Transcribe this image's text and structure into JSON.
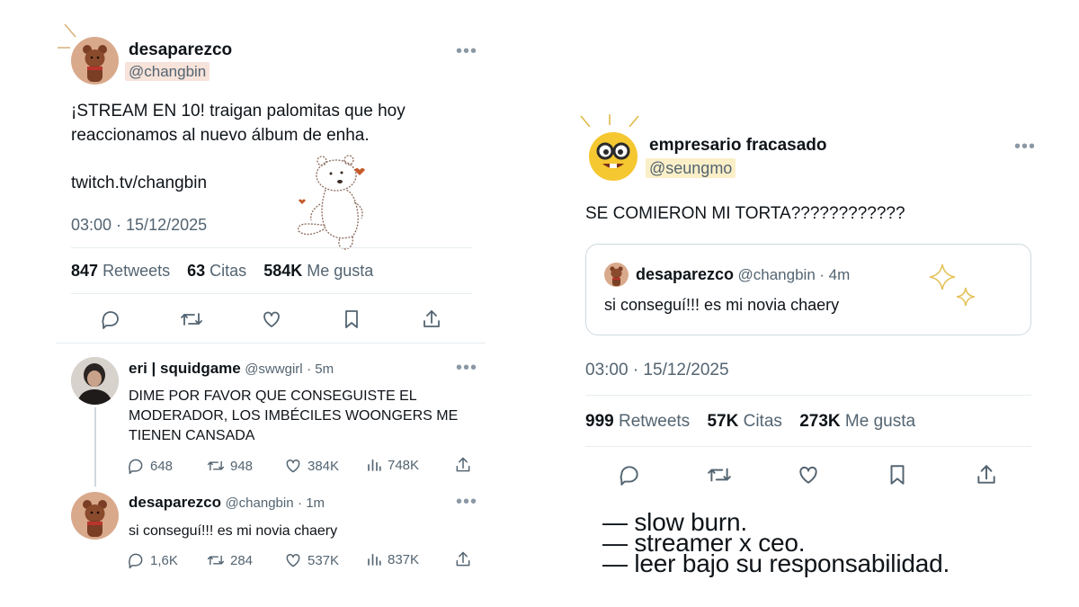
{
  "left_tweet": {
    "display_name": "desaparezco",
    "handle": "@changbin",
    "text_line1": "¡STREAM EN 10! traigan palomitas que hoy",
    "text_line2": "reaccionamos al nuevo álbum de enha.",
    "link": "twitch.tv/changbin",
    "timestamp": "03:00 · 15/12/2025",
    "retweets_count": "847",
    "retweets_label": "Retweets",
    "quotes_count": "63",
    "quotes_label": "Citas",
    "likes_count": "584K",
    "likes_label": "Me gusta"
  },
  "replies": [
    {
      "display_name": "eri | squidgame",
      "handle": "@swwgirl",
      "time": "· 5m",
      "text_line1": "DIME POR FAVOR QUE CONSEGUISTE EL",
      "text_line2": "MODERADOR, LOS IMBÉCILES WOONGERS ME",
      "text_line3": "TIENEN CANSADA",
      "replies": "648",
      "retweets": "948",
      "likes": "384K",
      "views": "748K"
    },
    {
      "display_name": "desaparezco",
      "handle": "@changbin",
      "time": "· 1m",
      "text_line1": "si conseguí!!! es mi novia chaery",
      "replies": "1,6K",
      "retweets": "284",
      "likes": "537K",
      "views": "837K"
    }
  ],
  "right_tweet": {
    "display_name": "empresario fracasado",
    "handle": "@seungmo",
    "text": "SE COMIERON MI TORTA????????????",
    "quoted": {
      "display_name": "desaparezco",
      "handle": "@changbin",
      "time": "· 4m",
      "text": "si conseguí!!! es mi novia chaery"
    },
    "timestamp": "03:00 · 15/12/2025",
    "retweets_count": "999",
    "retweets_label": "Retweets",
    "quotes_count": "57K",
    "quotes_label": "Citas",
    "likes_count": "273K",
    "likes_label": "Me gusta"
  },
  "footer": {
    "line1": "— slow burn.",
    "line2": "— streamer x ceo.",
    "line3": "— leer bajo su responsabilidad."
  },
  "icons": [
    "reply-icon",
    "retweet-icon",
    "like-icon",
    "bookmark-icon",
    "share-icon",
    "views-icon",
    "more-icon"
  ],
  "colors": {
    "text": "#0f1419",
    "muted": "#536471",
    "divider": "#e6ecf0",
    "handle_highlight": "#f7e3da"
  }
}
